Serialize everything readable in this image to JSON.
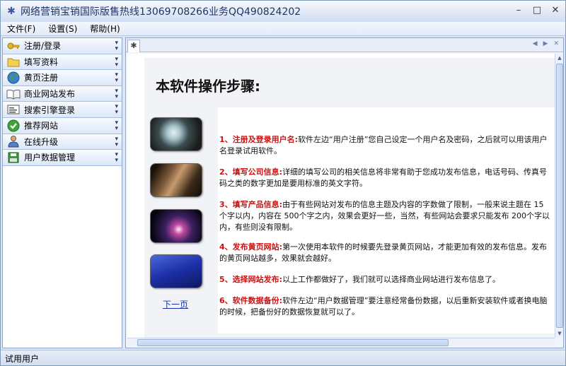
{
  "window": {
    "title": "网络营销宝销国际版售热线13069708266业务QQ490824202"
  },
  "menu": [
    {
      "label": "文件(F)"
    },
    {
      "label": "设置(S)"
    },
    {
      "label": "帮助(H)"
    }
  ],
  "sidebar": {
    "items": [
      {
        "label": "注册/登录",
        "icon": "key-icon"
      },
      {
        "label": "填写资料",
        "icon": "folder-icon"
      },
      {
        "label": "黄页注册",
        "icon": "globe-icon"
      },
      {
        "label": "商业网站发布",
        "icon": "book-icon"
      },
      {
        "label": "搜索引擎登录",
        "icon": "search-engine-icon"
      },
      {
        "label": "推荐网站",
        "icon": "check-icon"
      },
      {
        "label": "在线升级",
        "icon": "user-upgrade-icon"
      },
      {
        "label": "用户数据管理",
        "icon": "disk-icon"
      }
    ]
  },
  "content": {
    "heading": "本软件操作步骤:",
    "next_link": "下一页",
    "steps": [
      {
        "title": "1、注册及登录用户名:",
        "text": "软件左边“用户注册”您自己设定一个用户名及密码，之后就可以用该用户名登录试用软件。"
      },
      {
        "title": "2、填写公司信息:",
        "text": "详细的填写公司的相关信息将非常有助于您成功发布信息，电话号码、传真号码之类的数字更加是要用标准的英文字符。"
      },
      {
        "title": "3、填写产品信息:",
        "text": "由于有些网站对发布的信息主题及内容的字数做了限制，一般来说主题在 15个字以内，内容在 500个字之内，效果会更好一些，当然，有些网站会要求只能发布 200个字以内，有些则没有限制。"
      },
      {
        "title": "4、发布黄页网站:",
        "text": "第一次使用本软件的时候要先登录黄页网站，才能更加有效的发布信息。发布的黄页网站越多，效果就会越好。"
      },
      {
        "title": "5、选择网站发布:",
        "text": "以上工作都做好了，我们就可以选择商业网站进行发布信息了。"
      },
      {
        "title": "6、软件数据备份:",
        "text": "软件左边“用户数据管理”要注意经常备份数据，以后重新安装软件或者换电脑的时候，把备份好的数据恢复就可以了。"
      }
    ]
  },
  "status": {
    "text": "试用用户"
  }
}
